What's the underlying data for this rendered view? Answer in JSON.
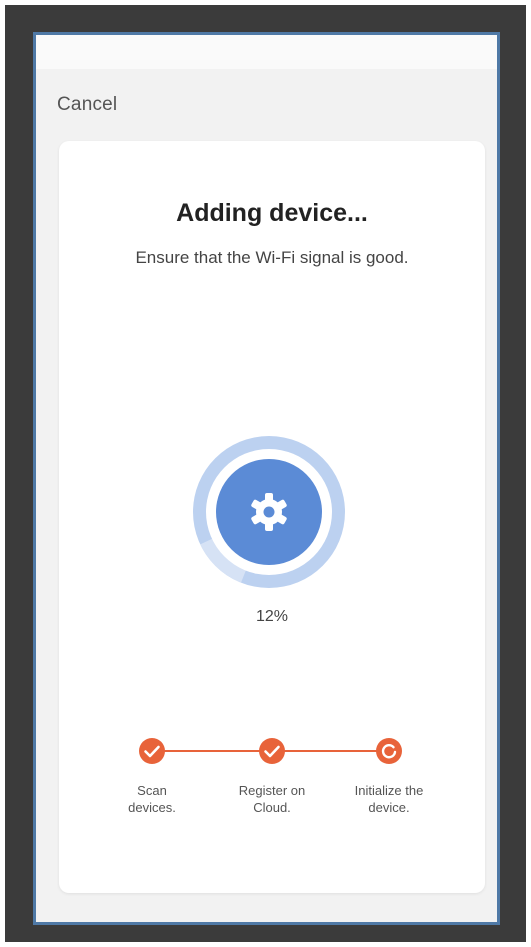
{
  "header": {
    "cancel_label": "Cancel"
  },
  "card": {
    "title": "Adding device...",
    "subtitle": "Ensure that the Wi-Fi signal is good."
  },
  "progress": {
    "value": 0.12,
    "label": "12%"
  },
  "steps": [
    {
      "label_line1": "Scan",
      "label_line2": "devices.",
      "status": "done"
    },
    {
      "label_line1": "Register on",
      "label_line2": "Cloud.",
      "status": "done"
    },
    {
      "label_line1": "Initialize the",
      "label_line2": "device.",
      "status": "in-progress"
    }
  ],
  "icons": {
    "center": "gear-icon",
    "step_done": "check-icon",
    "step_pending": "loading-icon"
  },
  "colors": {
    "accent": "#e8633a",
    "ring_inner": "#5b8bd6",
    "ring_outer": "#bcd1f0",
    "ring_track": "#d6e2f5",
    "background": "#f2f2f2"
  }
}
